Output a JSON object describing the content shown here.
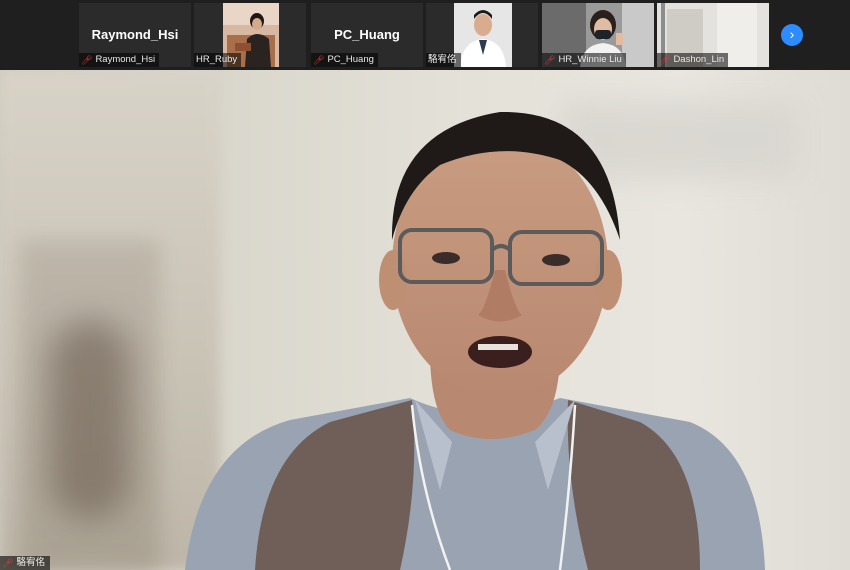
{
  "participants": [
    {
      "display": "Raymond_Hsi",
      "label": "Raymond_Hsi"
    },
    {
      "display": "",
      "label": "HR_Ruby"
    },
    {
      "display": "PC_Huang",
      "label": "PC_Huang"
    },
    {
      "display": "",
      "label": "駱宥佲"
    },
    {
      "display": "",
      "label": "HR_Winnie Liu"
    },
    {
      "display": "",
      "label": "Dashon_Lin"
    }
  ],
  "speaker_label": "駱宥佲",
  "icons": {
    "mic_muted": "mic-muted-icon",
    "next": "chevron-right-icon"
  },
  "colors": {
    "accent": "#2d8cff",
    "muted": "#e23b3b"
  }
}
